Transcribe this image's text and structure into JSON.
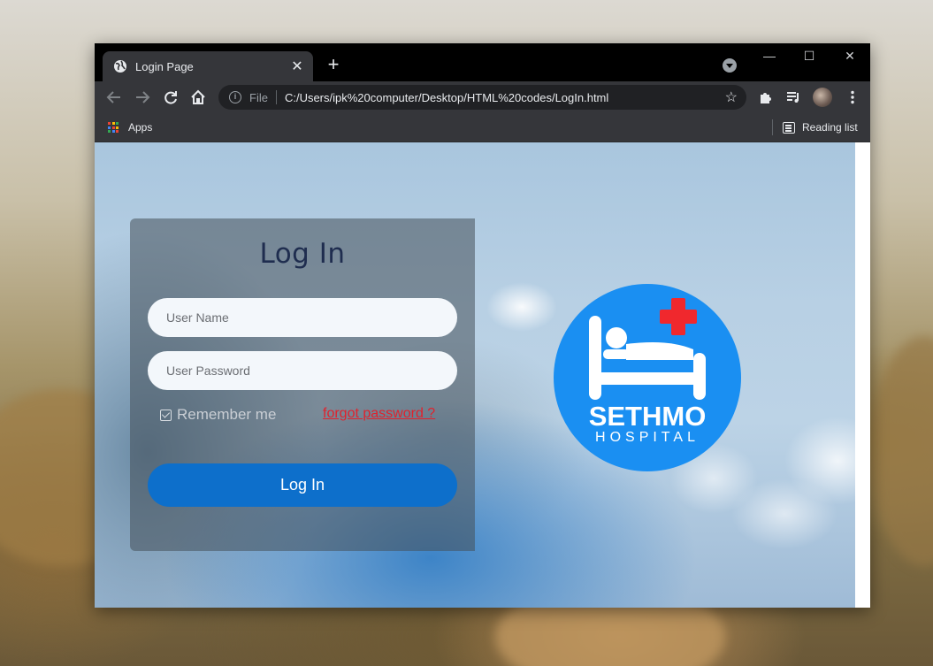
{
  "browser": {
    "tab_title": "Login Page",
    "tab_close": "✕",
    "new_tab": "+",
    "omnibox": {
      "scheme_label": "File",
      "url": "C:/Users/ipk%20computer/Desktop/HTML%20codes/LogIn.html"
    },
    "bookmarks": {
      "apps_label": "Apps",
      "reading_list_label": "Reading list"
    }
  },
  "page": {
    "login": {
      "title": "Log In",
      "username_placeholder": "User Name",
      "password_placeholder": "User Password",
      "remember_label": "Remember me",
      "remember_checked": true,
      "forgot_label": "forgot password ?",
      "submit_label": "Log In"
    },
    "logo": {
      "brand_name": "SETHMO",
      "brand_sub": "HOSPITAL",
      "colors": {
        "circle": "#1a8ff2",
        "cross": "#f0282d"
      }
    }
  },
  "colors": {
    "accent_button": "#0d6fcb",
    "forgot_link": "#e0222d",
    "title_text": "#1f2d4f"
  },
  "icons": [
    "globe-icon",
    "back-arrow-icon",
    "forward-arrow-icon",
    "reload-icon",
    "home-icon",
    "info-icon",
    "star-icon",
    "extensions-icon",
    "media-queue-icon",
    "profile-avatar",
    "more-menu-icon",
    "apps-grid-icon",
    "reading-list-icon",
    "checkbox-checked-icon",
    "hospital-bed-icon",
    "medical-cross-icon"
  ]
}
